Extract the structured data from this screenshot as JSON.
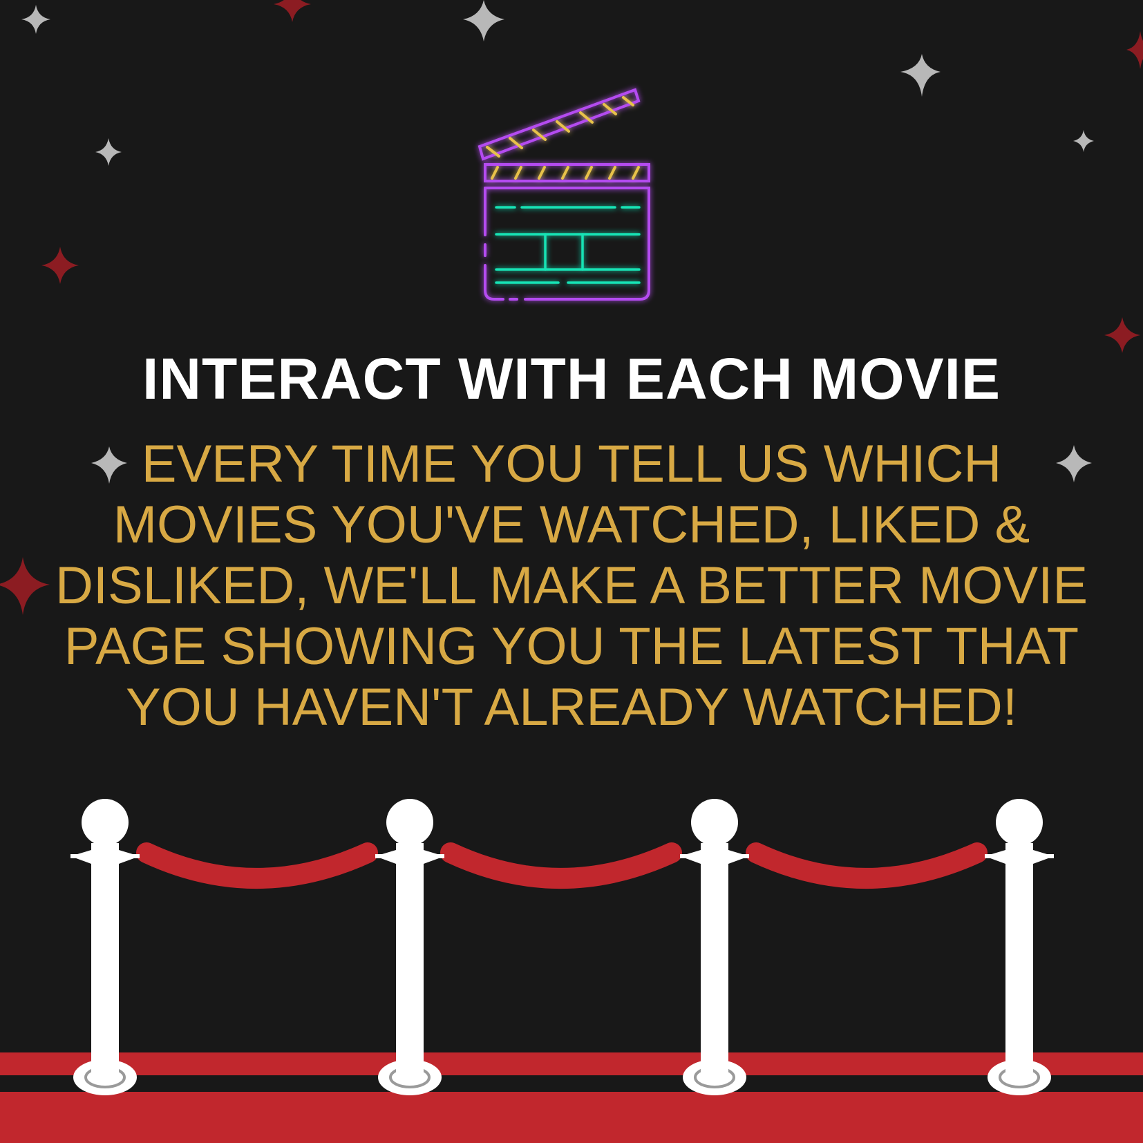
{
  "colors": {
    "background": "#181818",
    "headline": "#ffffff",
    "body": "#d8a944",
    "rope": "#c1272d",
    "carpet": "#c1272d",
    "post": "#ffffff",
    "star_silver": "#b8b8b8",
    "star_red": "#8c1c22",
    "clapper_frame": "#b44cf0",
    "clapper_stripes": "#e8c24a",
    "clapper_lines": "#19e3b5"
  },
  "icons": {
    "clapperboard": "clapperboard-icon",
    "stanchion": "stanchion-post",
    "sparkle": "sparkle-star"
  },
  "headline": "INTERACT WITH EACH MOVIE",
  "body_lines": [
    "EVERY TIME YOU TELL US WHICH",
    "MOVIES YOU'VE WATCHED, LIKED &",
    "DISLIKED, WE'LL MAKE A BETTER MOVIE",
    "PAGE SHOWING YOU THE LATEST THAT",
    "YOU HAVEN'T ALREADY WATCHED!"
  ]
}
